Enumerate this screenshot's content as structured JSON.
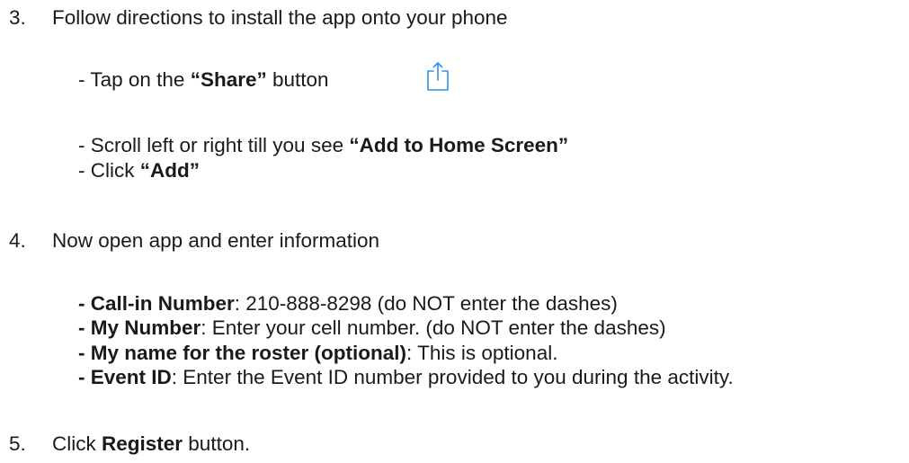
{
  "steps": [
    {
      "number": "3.",
      "text": "Follow directions to install the app onto your phone"
    },
    {
      "number": "4.",
      "text": "Now open app and enter information"
    },
    {
      "number": "5.",
      "text_before": "Click ",
      "bold": "Register",
      "text_after": " button."
    }
  ],
  "step3_bullets": [
    {
      "prefix": "- Tap on the ",
      "bold": "“Share”",
      "suffix": " button"
    },
    {
      "prefix": "- Scroll left or right till you see ",
      "bold": "“Add to Home Screen”",
      "suffix": ""
    },
    {
      "prefix": "- Click ",
      "bold": "“Add”",
      "suffix": ""
    }
  ],
  "step4_bullets": [
    {
      "bold": "- Call-in Number",
      "suffix": ": 210-888-8298  (do NOT enter the dashes)"
    },
    {
      "bold": "- My Number",
      "suffix": ": Enter your cell number.  (do NOT enter the dashes)"
    },
    {
      "bold": "- My name for the roster (optional)",
      "suffix": ": This is optional."
    },
    {
      "bold": "- Event ID",
      "suffix": ": Enter the Event ID number provided to you during the activity."
    }
  ],
  "icons": {
    "share": "share-icon",
    "share_color": "#2d8ff0"
  }
}
